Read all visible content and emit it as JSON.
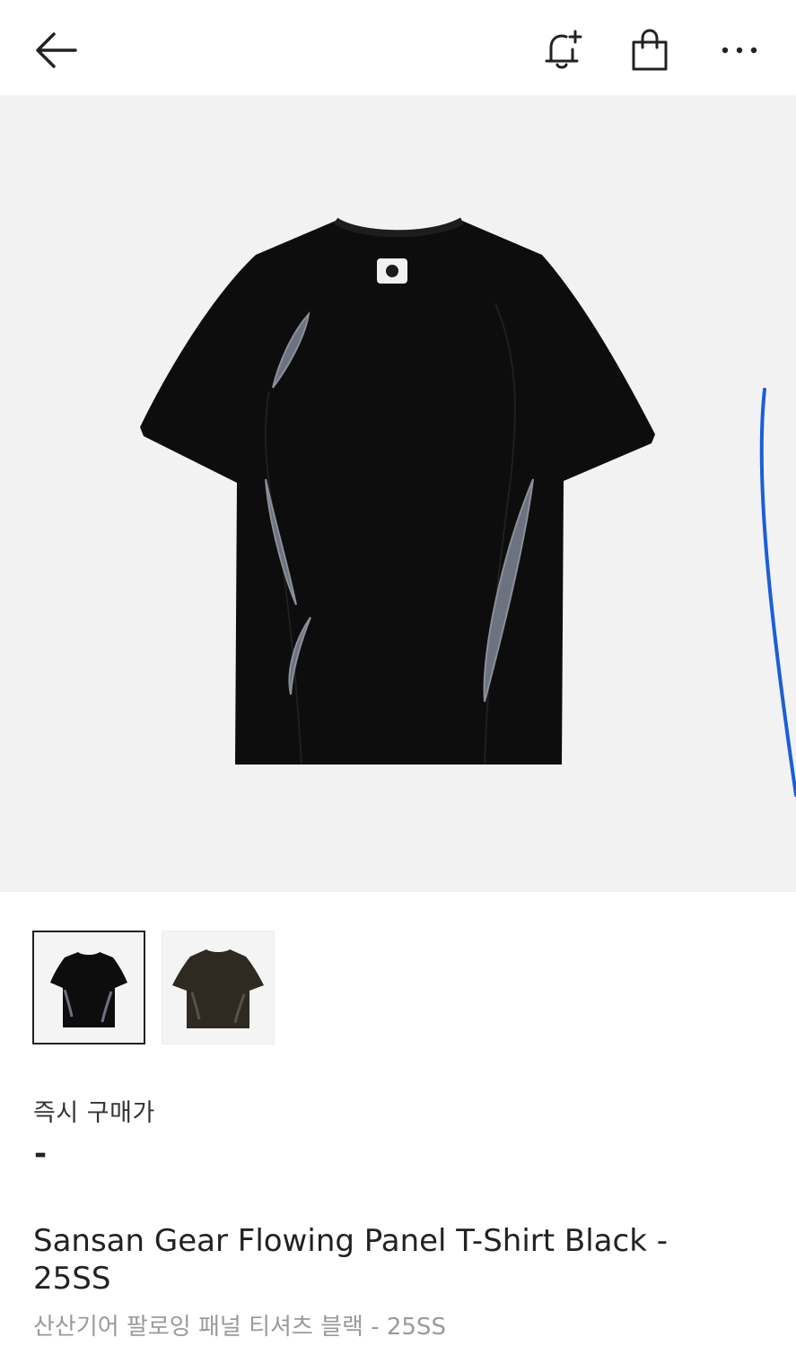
{
  "header": {
    "back_icon": "arrow-left-icon",
    "alert_icon": "bell-plus-icon",
    "cart_icon": "shopping-bag-icon",
    "more_icon": "more-horizontal-icon"
  },
  "gallery": {
    "main_image": "black t-shirt with grey flowing side panels",
    "thumbnails": [
      {
        "label": "black",
        "selected": true
      },
      {
        "label": "brown",
        "selected": false
      }
    ]
  },
  "price": {
    "label": "즉시 구매가",
    "value": "-"
  },
  "product": {
    "title": "Sansan Gear Flowing Panel T-Shirt Black - 25SS",
    "subtitle": "산산기어 팔로잉 패널 티셔츠 블랙 - 25SS"
  },
  "colors": {
    "background": "#ffffff",
    "hero_bg": "#f2f2f2",
    "shirt_black": "#0d0d0d",
    "panel_grey": "#6c7280",
    "annotation_blue": "#1a5fd6",
    "subtitle_grey": "#9a9a9a"
  }
}
